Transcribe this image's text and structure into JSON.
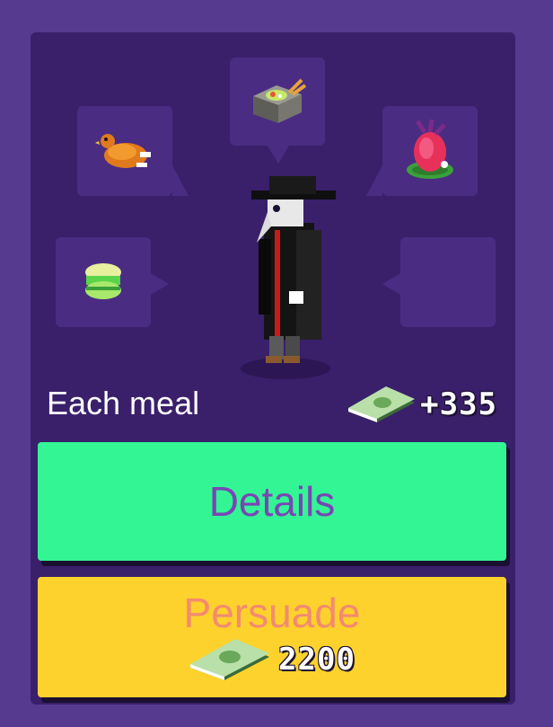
{
  "panel": {
    "each_meal_label": "Each meal",
    "income": "+335"
  },
  "orders": [
    {
      "slot": "top",
      "icon": "sushi-box-icon"
    },
    {
      "slot": "top-left",
      "icon": "roast-chicken-icon"
    },
    {
      "slot": "top-right",
      "icon": "dragon-fruit-icon"
    },
    {
      "slot": "mid-left",
      "icon": "macaron-icon"
    },
    {
      "slot": "mid-right",
      "icon": ""
    }
  ],
  "character": {
    "icon": "plague-doctor-icon"
  },
  "buttons": {
    "details_label": "Details",
    "persuade_label": "Persuade",
    "persuade_cost": "2200"
  },
  "colors": {
    "background": "#553a8f",
    "panel": "#3a1f6b",
    "bubble": "#4a2d82",
    "details": "#33f594",
    "persuade": "#fed22c",
    "details_text": "#7a45b5",
    "persuade_text": "#f48a6e"
  }
}
